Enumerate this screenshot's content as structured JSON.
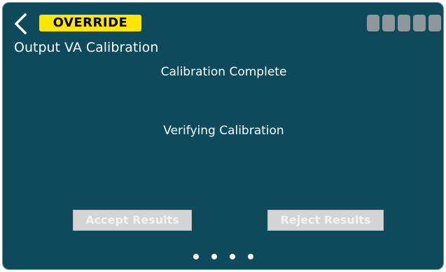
{
  "header": {
    "back_icon": "chevron-left-icon",
    "badge_label": "OVERRIDE",
    "signal_icon": "signal-strength-icon",
    "signal_bars": 5
  },
  "page": {
    "title": "Output VA Calibration"
  },
  "status": {
    "line1": "Calibration Complete",
    "line2": "Verifying Calibration"
  },
  "actions": {
    "accept_label": "Accept Results",
    "reject_label": "Reject Results",
    "accept_enabled": false,
    "reject_enabled": false
  },
  "pagination": {
    "total_pages": 4
  },
  "colors": {
    "background": "#0c4a5c",
    "badge": "#ffe600",
    "text": "#ffffff",
    "disabled_button": "#d4d4d4",
    "signal_bar": "#8e979a"
  }
}
